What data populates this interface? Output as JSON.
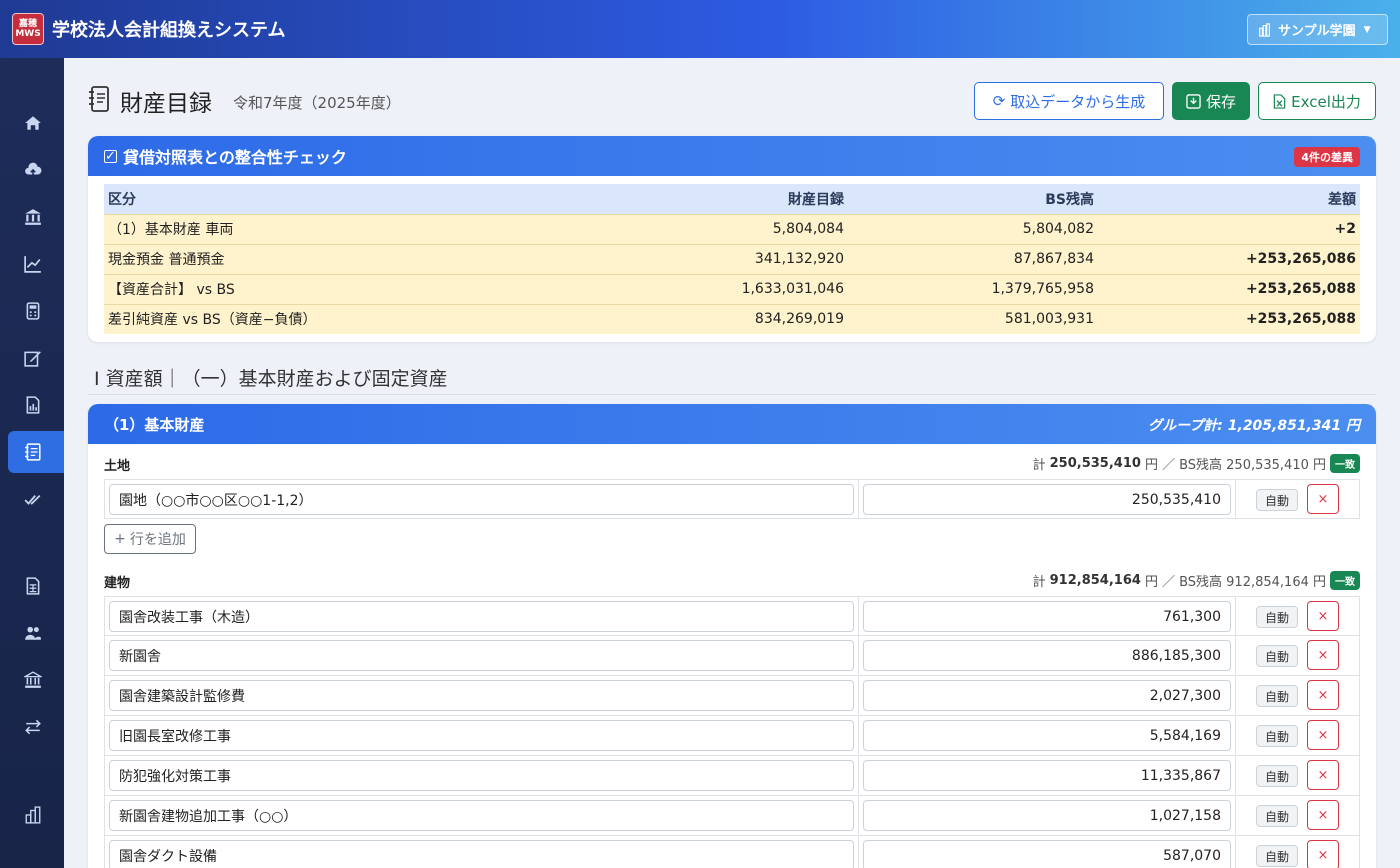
{
  "app": {
    "title": "学校法人会計組換えシステム",
    "logo_line1": "嘉穂",
    "logo_line2": "MWS"
  },
  "school_select": {
    "value": "サンプル学園"
  },
  "sidebar": {
    "items": [
      {
        "name": "home-icon"
      },
      {
        "name": "cloud-upload-icon"
      },
      {
        "name": "bank-icon"
      },
      {
        "name": "chart-line-icon"
      },
      {
        "name": "calculator-icon"
      },
      {
        "name": "edit-icon"
      },
      {
        "name": "report-icon"
      },
      {
        "name": "ledger-icon",
        "active": true
      },
      {
        "name": "double-check-icon"
      },
      {
        "name": "spreadsheet-icon"
      },
      {
        "name": "users-icon"
      },
      {
        "name": "institution-icon"
      },
      {
        "name": "transfer-icon"
      },
      {
        "name": "building-icon"
      }
    ]
  },
  "page": {
    "title": "財産目録",
    "subtitle": "令和7年度（2025年度）"
  },
  "actions": {
    "generate": "取込データから生成",
    "save": "保存",
    "excel": "Excel出力"
  },
  "check": {
    "title": "貸借対照表との整合性チェック",
    "badge": "4件の差異",
    "headers": {
      "category": "区分",
      "inventory": "財産目録",
      "bs": "BS残高",
      "diff": "差額"
    },
    "rows": [
      {
        "category": "（1）基本財産 車両",
        "inventory": "5,804,084",
        "bs": "5,804,082",
        "diff": "+2"
      },
      {
        "category": "現金預金 普通預金",
        "inventory": "341,132,920",
        "bs": "87,867,834",
        "diff": "+253,265,086"
      },
      {
        "category": "【資産合計】 vs BS",
        "inventory": "1,633,031,046",
        "bs": "1,379,765,958",
        "diff": "+253,265,088"
      },
      {
        "category": "差引純資産 vs BS（資産−負債）",
        "inventory": "834,269,019",
        "bs": "581,003,931",
        "diff": "+253,265,088"
      }
    ]
  },
  "section": {
    "title": "Ⅰ 資産額｜（一）基本財産および固定資産"
  },
  "group": {
    "title": "（1）基本財産",
    "total": "グループ計: 1,205,851,341 円",
    "subgroups": [
      {
        "label": "土地",
        "total_prefix": "計",
        "total": "250,535,410",
        "unit": "円",
        "bs_text": "／ BS残高 250,535,410 円",
        "status": "一致",
        "rows": [
          {
            "name": "園地（○○市○○区○○1-1,2）",
            "amount": "250,535,410",
            "auto": "自動",
            "del": "×"
          }
        ],
        "add_label": "行を追加"
      },
      {
        "label": "建物",
        "total_prefix": "計",
        "total": "912,854,164",
        "unit": "円",
        "bs_text": "／ BS残高 912,854,164 円",
        "status": "一致",
        "rows": [
          {
            "name": "園舎改装工事（木造）",
            "amount": "761,300",
            "auto": "自動",
            "del": "×"
          },
          {
            "name": "新園舎",
            "amount": "886,185,300",
            "auto": "自動",
            "del": "×"
          },
          {
            "name": "園舎建築設計監修費",
            "amount": "2,027,300",
            "auto": "自動",
            "del": "×"
          },
          {
            "name": "旧園長室改修工事",
            "amount": "5,584,169",
            "auto": "自動",
            "del": "×"
          },
          {
            "name": "防犯強化対策工事",
            "amount": "11,335,867",
            "auto": "自動",
            "del": "×"
          },
          {
            "name": "新園舎建物追加工事（○○）",
            "amount": "1,027,158",
            "auto": "自動",
            "del": "×"
          },
          {
            "name": "園舎ダクト設備",
            "amount": "587,070",
            "auto": "自動",
            "del": "×"
          }
        ]
      }
    ]
  }
}
